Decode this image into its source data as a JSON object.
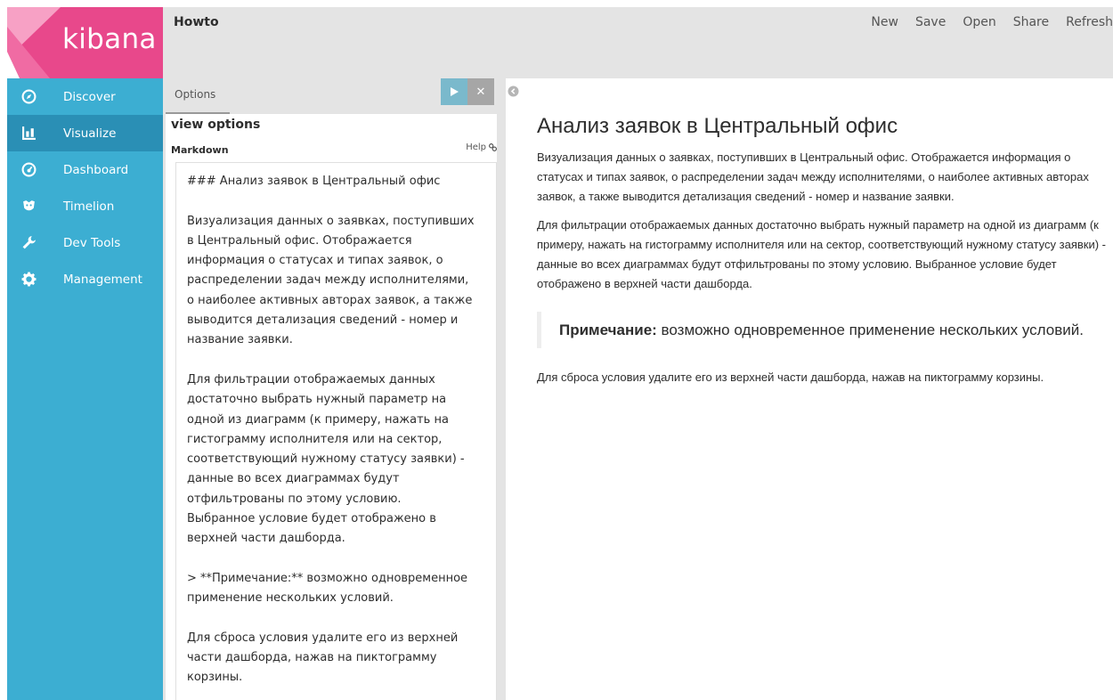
{
  "app": {
    "logo_text": "kibana"
  },
  "sidebar": {
    "items": [
      {
        "label": "Discover",
        "icon": "compass-icon"
      },
      {
        "label": "Visualize",
        "icon": "bar-chart-icon",
        "active": true
      },
      {
        "label": "Dashboard",
        "icon": "gauge-icon"
      },
      {
        "label": "Timelion",
        "icon": "timelion-icon"
      },
      {
        "label": "Dev Tools",
        "icon": "wrench-icon"
      },
      {
        "label": "Management",
        "icon": "gear-icon"
      }
    ]
  },
  "topbar": {
    "title": "Howto",
    "menu": [
      "New",
      "Save",
      "Open",
      "Share",
      "Refresh"
    ]
  },
  "editor": {
    "tab_label": "Options",
    "section_title": "view options",
    "field_label": "Markdown",
    "help_label": "Help",
    "markdown_lines": [
      "### Анализ заявок в Центральный офис",
      "",
      "Визуализация данных о заявках, поступивших",
      "в Центральный офис. Отображается",
      "информация о статусах и типах заявок, о",
      "распределении задач между исполнителями,",
      "о наиболее активных авторах заявок, а также",
      "выводится детализация сведений - номер и",
      "название заявки.",
      "",
      "Для фильтрации отображаемых данных",
      "достаточно выбрать нужный параметр на",
      "одной из диаграмм (к примеру, нажать на",
      "гистограмму исполнителя или на сектор,",
      "соответствующий нужному статусу заявки) -",
      "данные во всех диаграммах будут",
      "отфильтрованы по этому условию.",
      "Выбранное условие будет отображено в",
      "верхней части дашборда.",
      "",
      "> **Примечание:** возможно одновременное",
      "применение нескольких условий.",
      "",
      "Для сброса условия удалите его из верхней",
      "части дашборда, нажав на пиктограмму",
      "корзины."
    ]
  },
  "preview": {
    "heading": "Анализ заявок в Центральный офис",
    "para1": "Визуализация данных о заявках, поступивших в Центральный офис. Отображается информация о статусах и типах заявок, о распределении задач между исполнителями, о наиболее активных авторах заявок, а также выводится детализация сведений - номер и название заявки.",
    "para2": "Для фильтрации отображаемых данных достаточно выбрать нужный параметр на одной из диаграмм (к примеру, нажать на гистограмму исполнителя или на сектор, соответствующий нужному статусу заявки) - данные во всех диаграммах будут отфильтрованы по этому условию. Выбранное условие будет отображено в верхней части дашборда.",
    "note_bold": "Примечание:",
    "note_text": " возможно одновременное применение нескольких условий.",
    "para3": "Для сброса условия удалите его из верхней части дашборда, нажав на пиктограмму корзины."
  },
  "colors": {
    "sidebar": "#3caed2",
    "sidebar_active": "#2a8fb5",
    "logo_bg": "#e8488b",
    "topbar": "#e4e4e4",
    "apply_button": "#7ab9cc"
  }
}
